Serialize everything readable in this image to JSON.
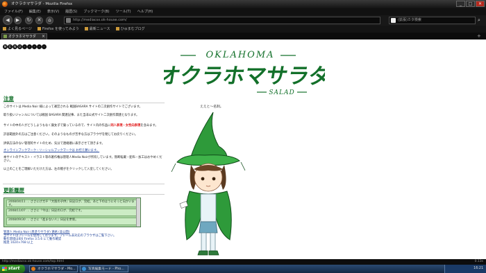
{
  "window": {
    "title": "オクラホマサラダ - Mozilla Firefox",
    "controls": [
      "_",
      "□",
      "×"
    ]
  },
  "menu": [
    "ファイル(F)",
    "編集(E)",
    "表示(V)",
    "履歴(S)",
    "ブックマーク(B)",
    "ツール(T)",
    "ヘルプ(H)"
  ],
  "nav": {
    "url": "http://mediacsx.ok-house.com/",
    "search_placeholder": "(拡張)カタ検索",
    "back": "◀",
    "forward": "▶",
    "reload": "↻",
    "stop": "✕",
    "home": "⌂"
  },
  "bookmarks": [
    "よく見るページ",
    "Firefox を使ってみよう",
    "最新ニュース",
    "ひゅまむブログ"
  ],
  "tab": {
    "label": "オクラホマサラダ"
  },
  "page": {
    "nav_pills": [
      "M",
      "E",
      "N",
      "U",
      "-",
      "-",
      "-",
      "-",
      "-"
    ],
    "logo_top": "OKLAHOMA",
    "logo_main": "オクラホマサラダ",
    "logo_bottom": "SALAD",
    "notice": {
      "heading": "注意",
      "p1": "このサイトは Media Noir 様によって運営される 戦国BASARA サイトの二次創作サイトでございます。",
      "p2": "取り扱いジャンルについては戦国 BASARA 関連記事、また当非公式サイト二次創作関連となります。",
      "p3a": "サイトの中の人がどうしようもなく腐女子で腐っているので、サイト内の作品に",
      "p3red": "同人表現・女性向表現",
      "p3b": "を含みます。",
      "p4": "許容範囲外の方はご注意ください。そのようなものが苦手な方はブラウザを閉じてお戻りください。",
      "p5": "評価方法のない管理的サイトのため、気分で連絡順に表示させて頂きます。",
      "p6link": "オンラインブックマーク・ソーシャルブックマークは お控え願います。",
      "p7": "本サイトのテキスト・イラスト等の著作権は管理人Media Noirが所有しています。無断転載・配布・加工はおやめください。",
      "p8": "以上のことをご理解いただけた方は、左の帽子をクリックして入室してください。"
    },
    "updates": {
      "heading": "更新履歴",
      "items": [
        "2008/04/11 … ささにげガチ『大阪の子供』日記ログ、完結。あと下のほうにそっと向かいます。",
        "2008/11/07 … ささに『今は』日記のログ、完結です。",
        "2008/09/30 … ささに『進まない人』日記を更新。"
      ]
    },
    "footer": [
      "管理人 Media Noir (黒塗りサラダ) 連絡 (非公開)",
      "当サイトはフレームを使用しております。フレーム非対応のブラウザはご覧下さい。",
      "動作環境はIE6 Firefox 3.5.6 にて動作確認",
      "推奨 1024×768 以上"
    ],
    "speech": "ええと～名刺。"
  },
  "status": {
    "text": "http://mediacsx.ok-house.com/top.html",
    "right": "0.13s"
  },
  "taskbar": {
    "start": "start",
    "tasks": [
      "オクラホマサラダ - Mo...",
      "写真編集モード - Pho..."
    ],
    "time": "16:21"
  },
  "colors": {
    "logo_green": "#13702a",
    "hat_green": "#2e9a3a",
    "update_box": "#a8d4a0",
    "link_blue": "#24469a",
    "warning_red": "#e01010"
  }
}
